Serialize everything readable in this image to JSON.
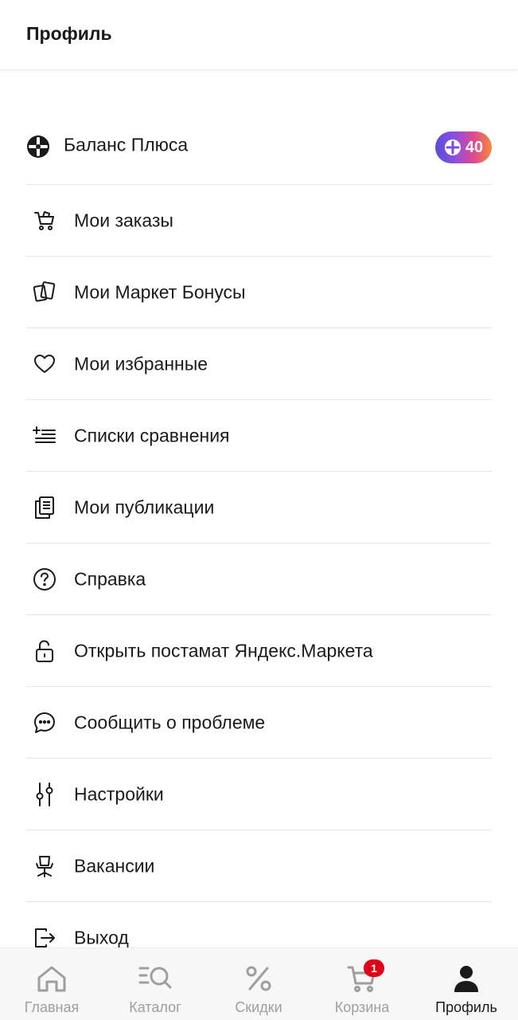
{
  "header": {
    "title": "Профиль"
  },
  "menu": {
    "plus": {
      "label": "Баланс Плюса",
      "balance": "40",
      "icon": "plus-points-icon"
    },
    "items": [
      {
        "label": "Мои заказы",
        "icon": "cart-orders-icon"
      },
      {
        "label": "Мои Маркет Бонусы",
        "icon": "bonus-cards-icon"
      },
      {
        "label": "Мои избранные",
        "icon": "heart-icon"
      },
      {
        "label": "Списки сравнения",
        "icon": "compare-list-icon"
      },
      {
        "label": "Мои публикации",
        "icon": "publications-icon"
      },
      {
        "label": "Справка",
        "icon": "help-icon"
      },
      {
        "label": "Открыть постамат Яндекс.Маркета",
        "icon": "unlock-icon"
      },
      {
        "label": "Сообщить о проблеме",
        "icon": "chat-icon"
      },
      {
        "label": "Настройки",
        "icon": "settings-sliders-icon"
      },
      {
        "label": "Вакансии",
        "icon": "office-chair-icon"
      },
      {
        "label": "Выход",
        "icon": "logout-icon"
      }
    ]
  },
  "tabbar": {
    "tabs": [
      {
        "label": "Главная",
        "icon": "home-icon"
      },
      {
        "label": "Каталог",
        "icon": "catalog-search-icon"
      },
      {
        "label": "Скидки",
        "icon": "percent-icon"
      },
      {
        "label": "Корзина",
        "icon": "cart-icon",
        "badge": "1"
      },
      {
        "label": "Профиль",
        "icon": "profile-icon",
        "active": true
      }
    ]
  },
  "colors": {
    "active_tab": "#1a1a1a",
    "inactive_tab": "#9e9e9e",
    "badge_red": "#e0001a"
  }
}
